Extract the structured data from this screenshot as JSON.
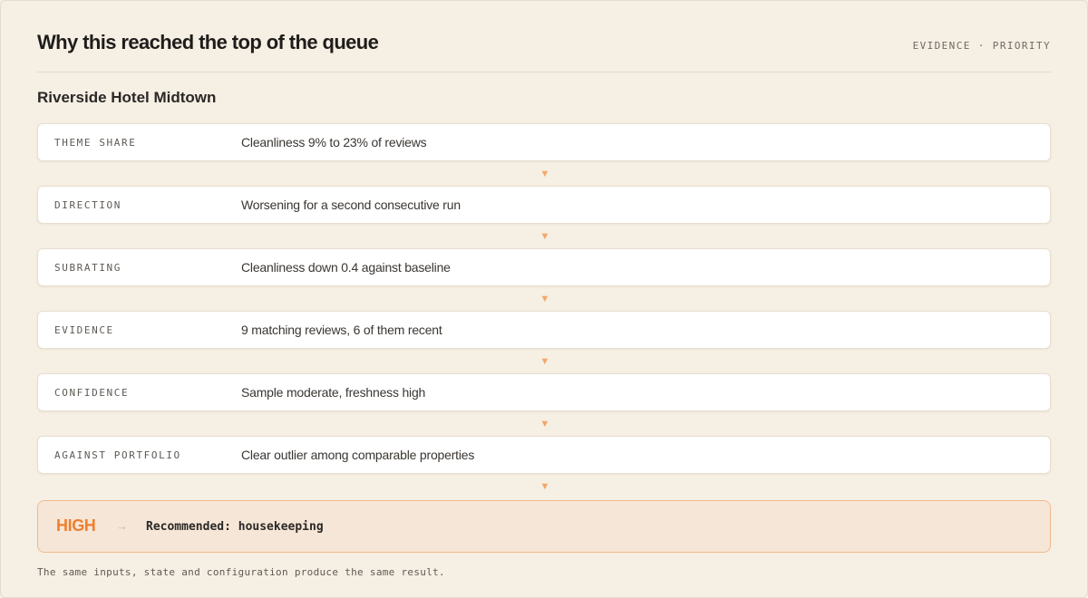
{
  "header": {
    "title": "Why this reached the top of the queue",
    "tag": "EVIDENCE · PRIORITY"
  },
  "property_name": "Riverside Hotel Midtown",
  "rows": [
    {
      "label": "THEME SHARE",
      "value": "Cleanliness 9% to 23% of reviews"
    },
    {
      "label": "DIRECTION",
      "value": "Worsening for a second consecutive run"
    },
    {
      "label": "SUBRATING",
      "value": "Cleanliness down 0.4 against baseline"
    },
    {
      "label": "EVIDENCE",
      "value": "9 matching reviews, 6 of them recent"
    },
    {
      "label": "CONFIDENCE",
      "value": "Sample moderate, freshness high"
    },
    {
      "label": "AGAINST PORTFOLIO",
      "value": "Clear outlier among comparable properties"
    }
  ],
  "connector_glyph": "▼",
  "result": {
    "priority": "HIGH",
    "arrow_glyph": "→",
    "recommendation": "Recommended: housekeeping"
  },
  "footnote": "The same inputs, state and configuration produce the same result.",
  "colors": {
    "accent": "#ef7f2e",
    "connector": "#f2a76b",
    "background": "#f6efe3",
    "result_background": "#f6e6d7"
  }
}
